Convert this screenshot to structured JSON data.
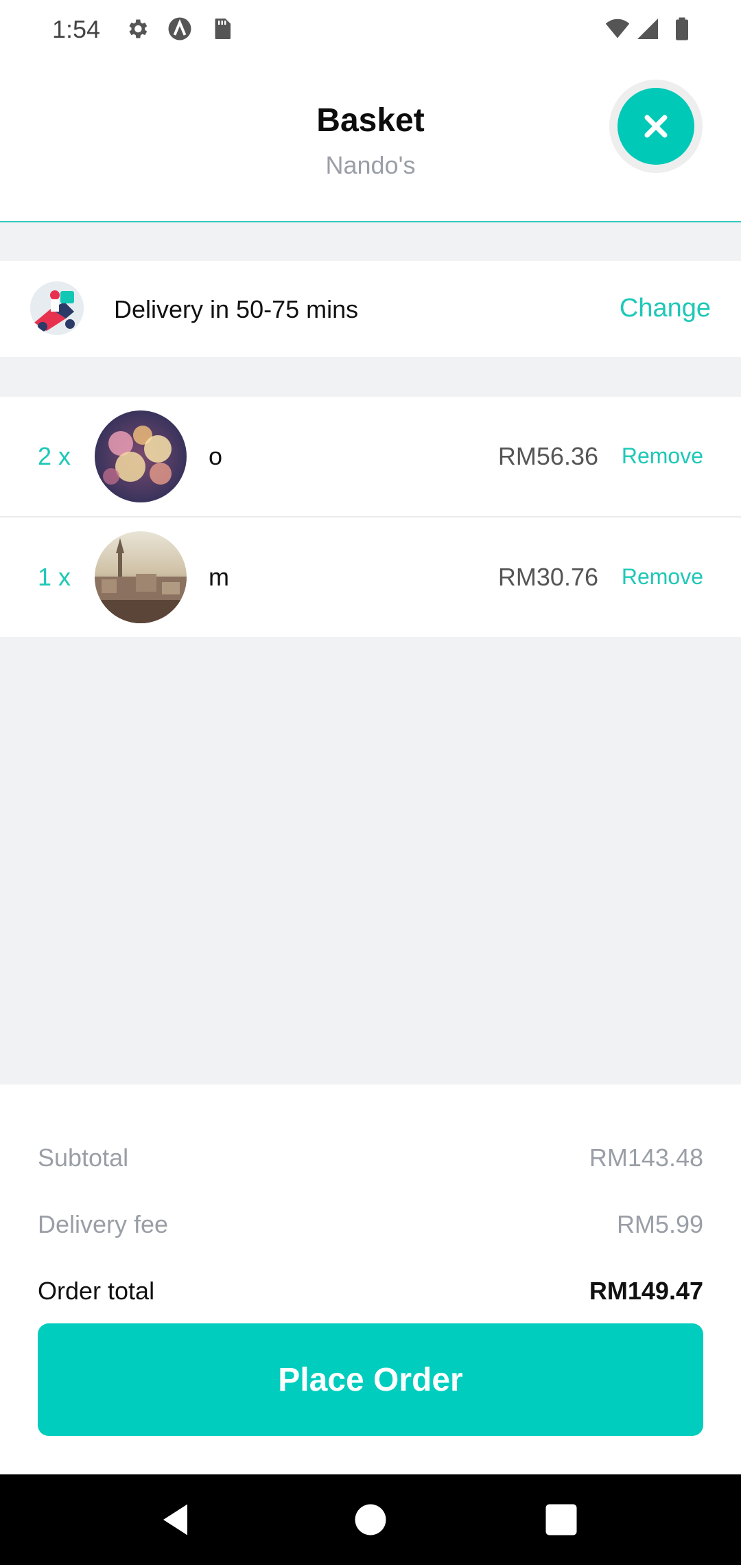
{
  "status_bar": {
    "time": "1:54",
    "icons": [
      "gear-icon",
      "a-circle-icon",
      "sd-card-icon",
      "wifi-icon",
      "signal-icon",
      "battery-icon"
    ]
  },
  "header": {
    "title": "Basket",
    "subtitle": "Nando's",
    "close_icon": "close-icon"
  },
  "delivery": {
    "text": "Delivery in 50-75 mins",
    "change_label": "Change"
  },
  "items": [
    {
      "qty": "2 x",
      "name": "o",
      "price": "RM56.36",
      "remove_label": "Remove"
    },
    {
      "qty": "1 x",
      "name": "m",
      "price": "RM30.76",
      "remove_label": "Remove"
    }
  ],
  "summary": {
    "subtotal_label": "Subtotal",
    "subtotal_value": "RM143.48",
    "delivery_fee_label": "Delivery fee",
    "delivery_fee_value": "RM5.99",
    "order_total_label": "Order total",
    "order_total_value": "RM149.47"
  },
  "place_order_label": "Place Order",
  "colors": {
    "accent": "#00c9b7",
    "muted_text": "#9a9ea6",
    "background_gray": "#f1f2f4"
  },
  "nav_bar": {
    "icons": [
      "back-icon",
      "home-icon",
      "recents-icon"
    ]
  }
}
